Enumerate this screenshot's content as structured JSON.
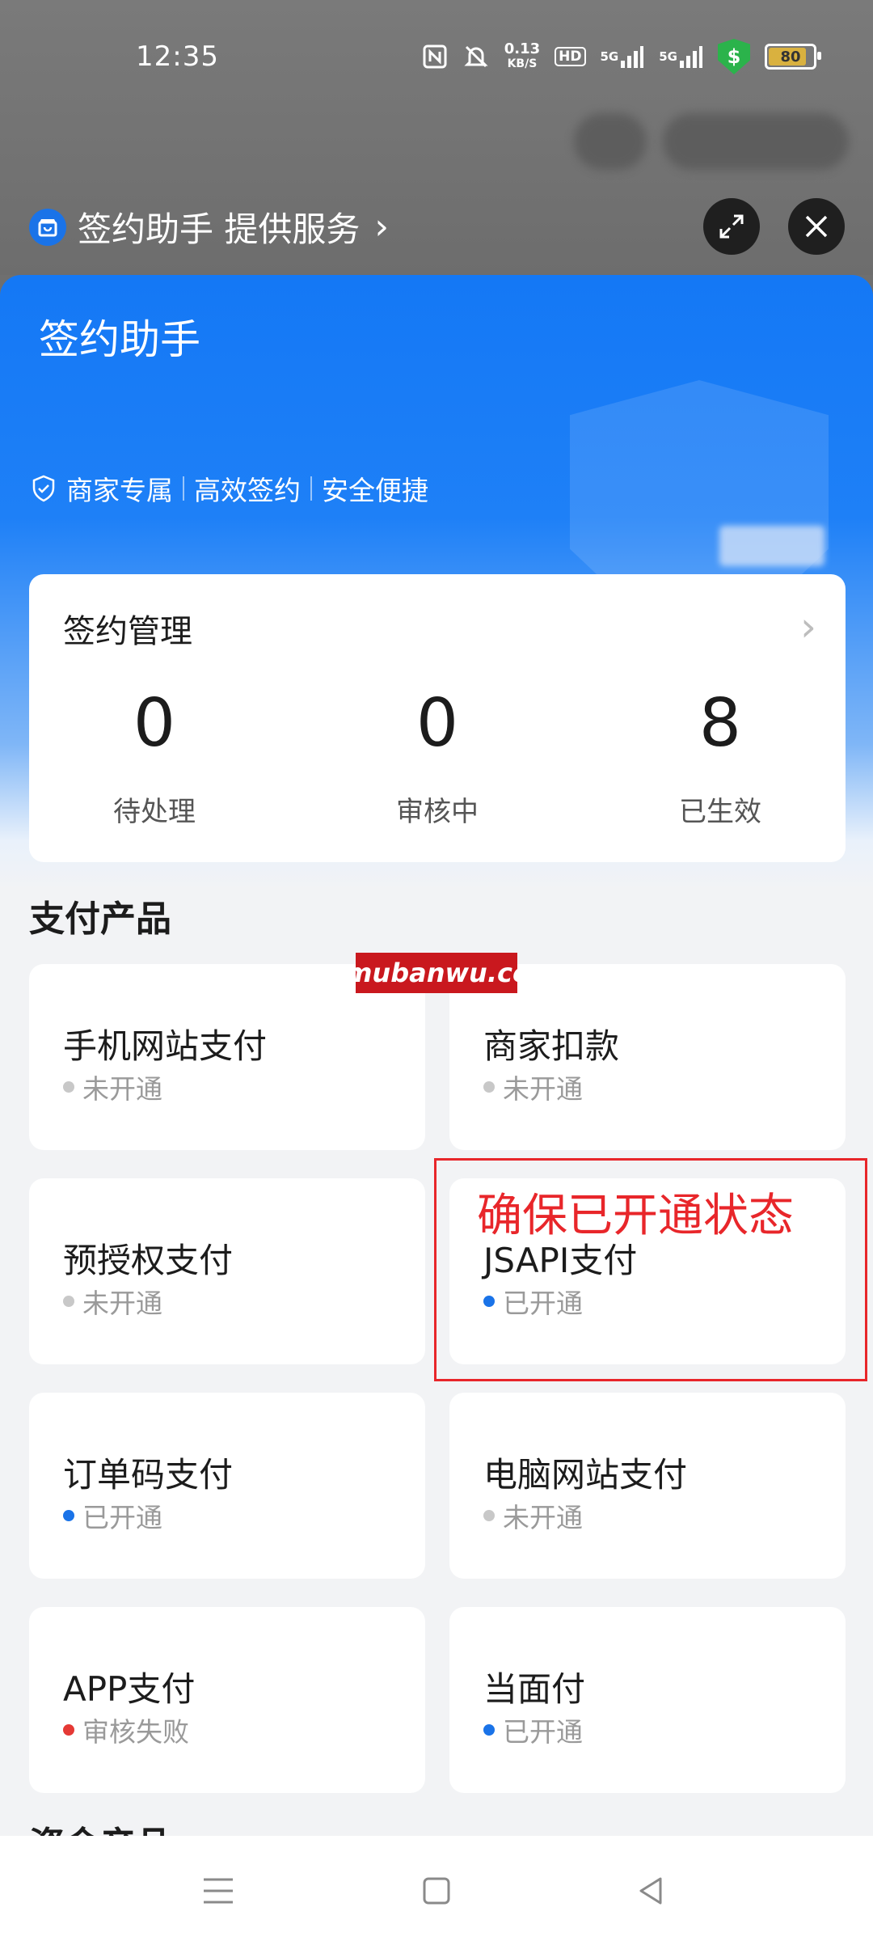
{
  "status_bar": {
    "time": "12:35",
    "net_speed_value": "0.13",
    "net_speed_unit": "KB/S",
    "hd_label": "HD",
    "sig1_label": "5G",
    "sig2_label": "5G",
    "shield_glyph": "$",
    "battery": "80",
    "icons": [
      "nfc-icon",
      "mute-icon",
      "signal-icon",
      "shield-icon",
      "battery-icon"
    ]
  },
  "service": {
    "label": "签约助手 提供服务",
    "chevron": "›"
  },
  "sheet": {
    "hero_title": "签约助手",
    "tags": [
      "商家专属",
      "高效签约",
      "安全便捷"
    ],
    "management": {
      "title": "签约管理",
      "chevron": "›",
      "stats": [
        {
          "value": "0",
          "label": "待处理"
        },
        {
          "value": "0",
          "label": "审核中"
        },
        {
          "value": "8",
          "label": "已生效"
        }
      ]
    },
    "section_title": "支付产品",
    "products": [
      {
        "name": "手机网站支付",
        "status": "未开通",
        "status_color": "#c8c8c8"
      },
      {
        "name": "商家扣款",
        "status": "未开通",
        "status_color": "#c8c8c8"
      },
      {
        "name": "预授权支付",
        "status": "未开通",
        "status_color": "#c8c8c8"
      },
      {
        "name": "JSAPI支付",
        "status": "已开通",
        "status_color": "#1a73e8"
      },
      {
        "name": "订单码支付",
        "status": "已开通",
        "status_color": "#1a73e8"
      },
      {
        "name": "电脑网站支付",
        "status": "未开通",
        "status_color": "#c8c8c8"
      },
      {
        "name": "APP支付",
        "status": "审核失败",
        "status_color": "#e53935"
      },
      {
        "name": "当面付",
        "status": "已开通",
        "status_color": "#1a73e8"
      }
    ],
    "next_section_partial": "资金产品",
    "watermark": "mubanwu.cc",
    "annotation": "确保已开通状态"
  },
  "colors": {
    "brand_blue": "#1478f5",
    "annotation_red": "#e8262a"
  }
}
